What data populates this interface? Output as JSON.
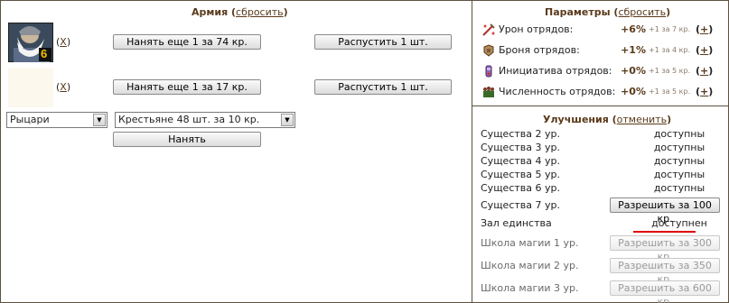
{
  "army": {
    "title": "Армия",
    "reset_link": "сбросить",
    "units": [
      {
        "portrait": "dwarf-warrior-portrait",
        "count": "6",
        "remove": "X",
        "hire_label": "Нанять еще 1 за 74 кр.",
        "dismiss_label": "Распустить 1 шт."
      },
      {
        "portrait": "empty-portrait",
        "count": "",
        "remove": "X",
        "hire_label": "Нанять еще 1 за 17 кр.",
        "dismiss_label": "Распустить 1 шт."
      }
    ],
    "faction_select": {
      "value": "Рыцари"
    },
    "unit_select": {
      "value": "Крестьяне 48 шт. за 10 кр."
    },
    "hire_button": "Нанять"
  },
  "params": {
    "title": "Параметры",
    "reset_link": "сбросить",
    "rows": [
      {
        "icon": "sword-damage-icon",
        "label": "Урон отрядов:",
        "value": "+6%",
        "cost": "+1 за 7 кр.",
        "plus": "+"
      },
      {
        "icon": "armor-icon",
        "label": "Броня отрядов:",
        "value": "+1%",
        "cost": "+1 за 4 кр.",
        "plus": "+"
      },
      {
        "icon": "initiative-icon",
        "label": "Инициатива отрядов:",
        "value": "+0%",
        "cost": "+1 за 5 кр.",
        "plus": "+"
      },
      {
        "icon": "troop-count-icon",
        "label": "Численность отрядов:",
        "value": "+0%",
        "cost": "+1 за 5 кр.",
        "plus": "+"
      }
    ]
  },
  "upgrades": {
    "title": "Улучшения",
    "cancel_link": "отменить",
    "rows": [
      {
        "name": "Существа 2 ур.",
        "status": "доступны"
      },
      {
        "name": "Существа 3 ур.",
        "status": "доступны"
      },
      {
        "name": "Существа 4 ур.",
        "status": "доступны"
      },
      {
        "name": "Существа 5 ур.",
        "status": "доступны"
      },
      {
        "name": "Существа 6 ур.",
        "status": "доступны"
      },
      {
        "name": "Существа 7 ур.",
        "button": "Разрешить за 100 кр."
      },
      {
        "name": "Зал единства",
        "status": "доступнен"
      },
      {
        "name": "Школа магии 1 ур.",
        "button": "Разрешить за 300 кр."
      },
      {
        "name": "Школа магии 2 ур.",
        "button": "Разрешить за 350 кр."
      },
      {
        "name": "Школа магии 3 ур.",
        "button": "Разрешить за 600 кр."
      }
    ]
  },
  "colors": {
    "border": "#5d5141",
    "title": "#5a3a1a",
    "underline_accent": "#e00000"
  }
}
